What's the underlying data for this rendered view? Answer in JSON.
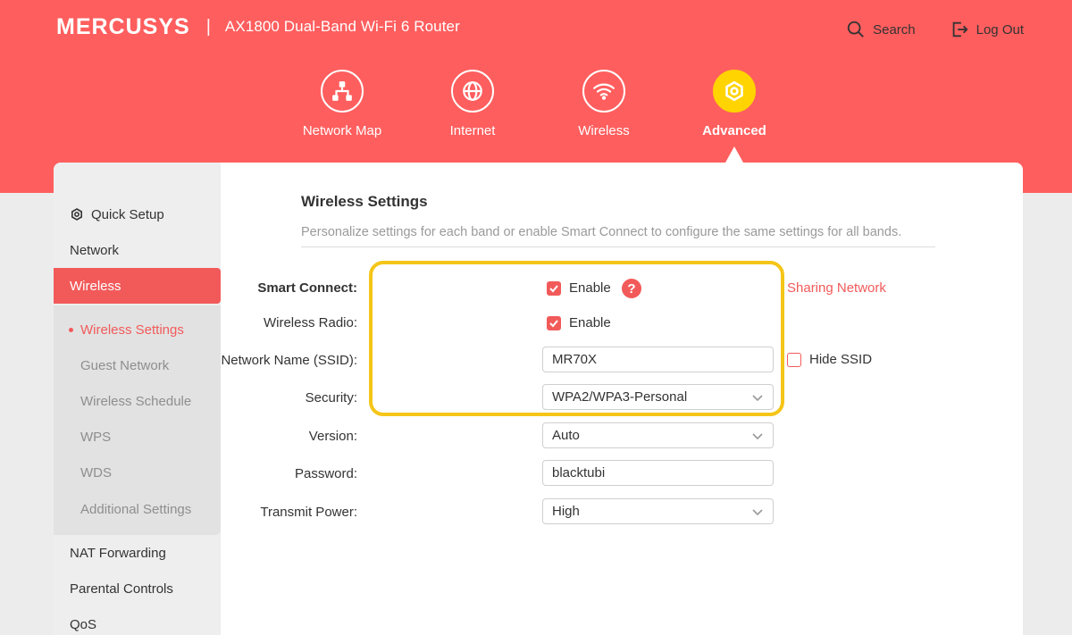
{
  "header": {
    "brand": "MERCUSYS",
    "separator": "|",
    "model": "AX1800 Dual-Band Wi-Fi 6 Router",
    "search_label": "Search",
    "logout_label": "Log Out"
  },
  "nav": {
    "items": [
      {
        "label": "Network Map",
        "icon": "network-map-icon"
      },
      {
        "label": "Internet",
        "icon": "globe-icon"
      },
      {
        "label": "Wireless",
        "icon": "wifi-icon"
      },
      {
        "label": "Advanced",
        "icon": "gear-icon",
        "active": true
      }
    ]
  },
  "sidebar": {
    "items": [
      {
        "label": "Quick Setup",
        "icon": "gear-icon"
      },
      {
        "label": "Network"
      },
      {
        "label": "Wireless",
        "active": true
      },
      {
        "label": "NAT Forwarding"
      },
      {
        "label": "Parental Controls"
      },
      {
        "label": "QoS"
      }
    ],
    "wireless_sub": [
      {
        "label": "Wireless Settings",
        "active": true
      },
      {
        "label": "Guest Network"
      },
      {
        "label": "Wireless Schedule"
      },
      {
        "label": "WPS"
      },
      {
        "label": "WDS"
      },
      {
        "label": "Additional Settings"
      }
    ]
  },
  "main": {
    "title": "Wireless Settings",
    "description": "Personalize settings for each band or enable Smart Connect to configure the same settings for all bands.",
    "smart_connect": {
      "label": "Smart Connect:",
      "option": "Enable",
      "checked": true,
      "help": "?",
      "link": "Sharing Network"
    },
    "wireless_radio": {
      "label": "Wireless Radio:",
      "option": "Enable",
      "checked": true
    },
    "ssid": {
      "label": "Network Name (SSID):",
      "value": "MR70X",
      "hide_label": "Hide SSID",
      "hide_checked": false
    },
    "security": {
      "label": "Security:",
      "value": "WPA2/WPA3-Personal"
    },
    "version": {
      "label": "Version:",
      "value": "Auto"
    },
    "password": {
      "label": "Password:",
      "value": "blacktubi"
    },
    "transmit_power": {
      "label": "Transmit Power:",
      "value": "High"
    }
  },
  "colors": {
    "brand_red": "#ff5e5e",
    "accent_red": "#f25a5a",
    "active_yellow": "#ffd400",
    "highlight_yellow": "#f5c518"
  }
}
